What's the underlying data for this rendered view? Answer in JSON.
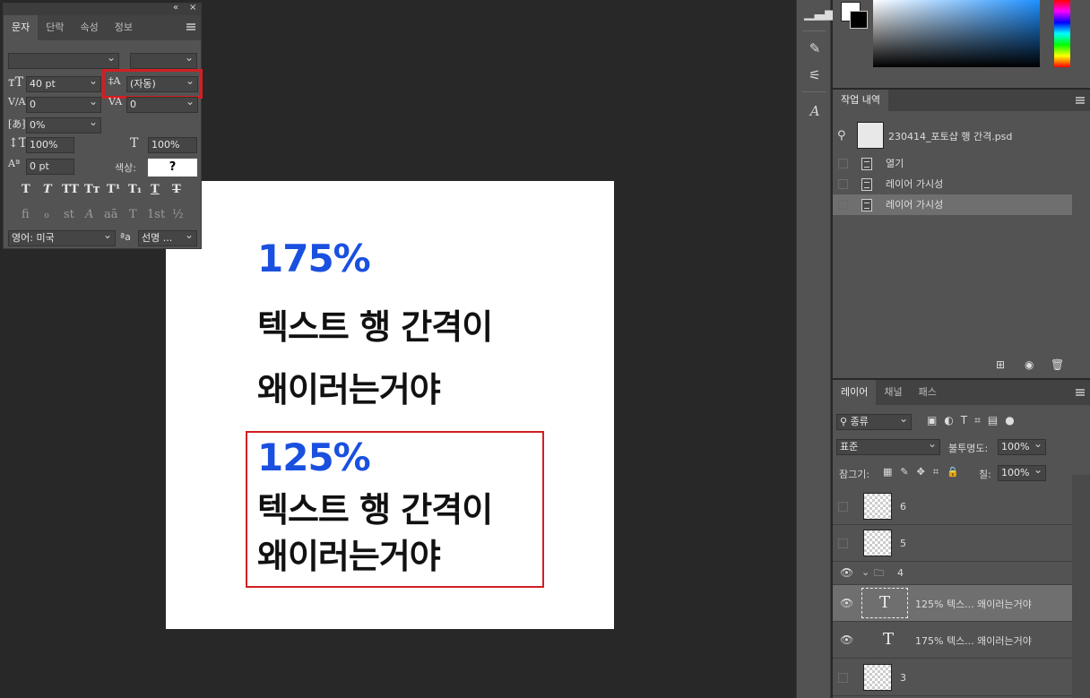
{
  "canvas": {
    "block1_pct": "175%",
    "block1_line1": "텍스트 행 간격이",
    "block1_line2": "왜이러는거야",
    "block2_pct": "125%",
    "block2_line1": "텍스트 행 간격이",
    "block2_line2": "왜이러는거야"
  },
  "char_panel": {
    "collapse_icon": "double-chevron-left",
    "close_icon": "close",
    "tabs": [
      "문자",
      "단락",
      "속성",
      "정보"
    ],
    "active_tab": "문자",
    "font_family": "",
    "font_style": "",
    "font_size": "40 pt",
    "leading": "(자동)",
    "kerning": "0",
    "tracking": "0",
    "tsume": "0%",
    "vertical_scale": "100%",
    "horizontal_scale": "100%",
    "baseline_shift": "0 pt",
    "color_label": "색상:",
    "color_value": "?",
    "type_styles": [
      "T",
      "T",
      "TT",
      "Tт",
      "T¹",
      "T₁",
      "T",
      "T"
    ],
    "opentype": [
      "fi",
      "ℴ",
      "st",
      "A",
      "aā",
      "T",
      "1st",
      "½"
    ],
    "language": "영어: 미국",
    "aa_label": "ªa",
    "antialias": "선명 ..."
  },
  "history": {
    "tabs": [
      "작업 내역"
    ],
    "snapshot_name": "230414_포토샵 행 간격.psd",
    "items": [
      "열기",
      "레이어 가시성",
      "레이어 가시성"
    ]
  },
  "layers": {
    "tabs": [
      "레이어",
      "채널",
      "패스"
    ],
    "filter_kind": "종류",
    "blend_mode": "표준",
    "opacity_label": "불투명도:",
    "opacity": "100%",
    "lock_label": "잠그기:",
    "fill_label": "칠:",
    "fill": "100%",
    "rows": [
      {
        "name": "6",
        "visible": false,
        "kind": "raster"
      },
      {
        "name": "5",
        "visible": false,
        "kind": "raster"
      },
      {
        "name": "4",
        "visible": true,
        "kind": "group"
      },
      {
        "name": "125% 텍스... 왜이러는거야",
        "visible": true,
        "kind": "text"
      },
      {
        "name": "175% 텍스... 왜이러는거야",
        "visible": true,
        "kind": "text"
      },
      {
        "name": "3",
        "visible": false,
        "kind": "raster"
      }
    ]
  },
  "colors": {
    "accent_blue": "#1a50e0",
    "highlight_red": "#d21f22"
  }
}
